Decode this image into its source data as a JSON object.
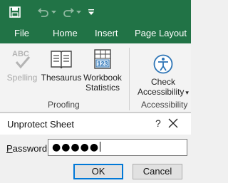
{
  "qat": {
    "icons": [
      "save-icon",
      "undo-icon",
      "redo-icon",
      "customize-qat-icon"
    ],
    "customize_glyph": "▾"
  },
  "tabs": [
    {
      "label": "File"
    },
    {
      "label": "Home"
    },
    {
      "label": "Insert"
    },
    {
      "label": "Page Layout"
    }
  ],
  "ribbon": {
    "spelling": {
      "abc": "ABC",
      "label": "Spelling",
      "icon": "spelling-check-icon",
      "enabled": false
    },
    "thesaurus": {
      "label": "Thesaurus",
      "icon": "book-icon"
    },
    "workbook_stats": {
      "line1": "Workbook",
      "line2": "Statistics",
      "icon": "statistics-icon",
      "icon_text": "123"
    },
    "check_accessibility": {
      "line1": "Check",
      "line2": "Accessibility",
      "icon": "accessibility-icon",
      "dropdown_glyph": "▾"
    },
    "groups": {
      "proofing": "Proofing",
      "accessibility": "Accessibility"
    }
  },
  "dialog": {
    "title": "Unprotect Sheet",
    "help_glyph": "?",
    "password_label_accel": "P",
    "password_label_rest": "assword:",
    "password_value": "●●●●●",
    "ok_label": "OK",
    "cancel_label": "Cancel"
  },
  "colors": {
    "excel_green": "#217346",
    "ok_focus_border": "#0078d7"
  }
}
